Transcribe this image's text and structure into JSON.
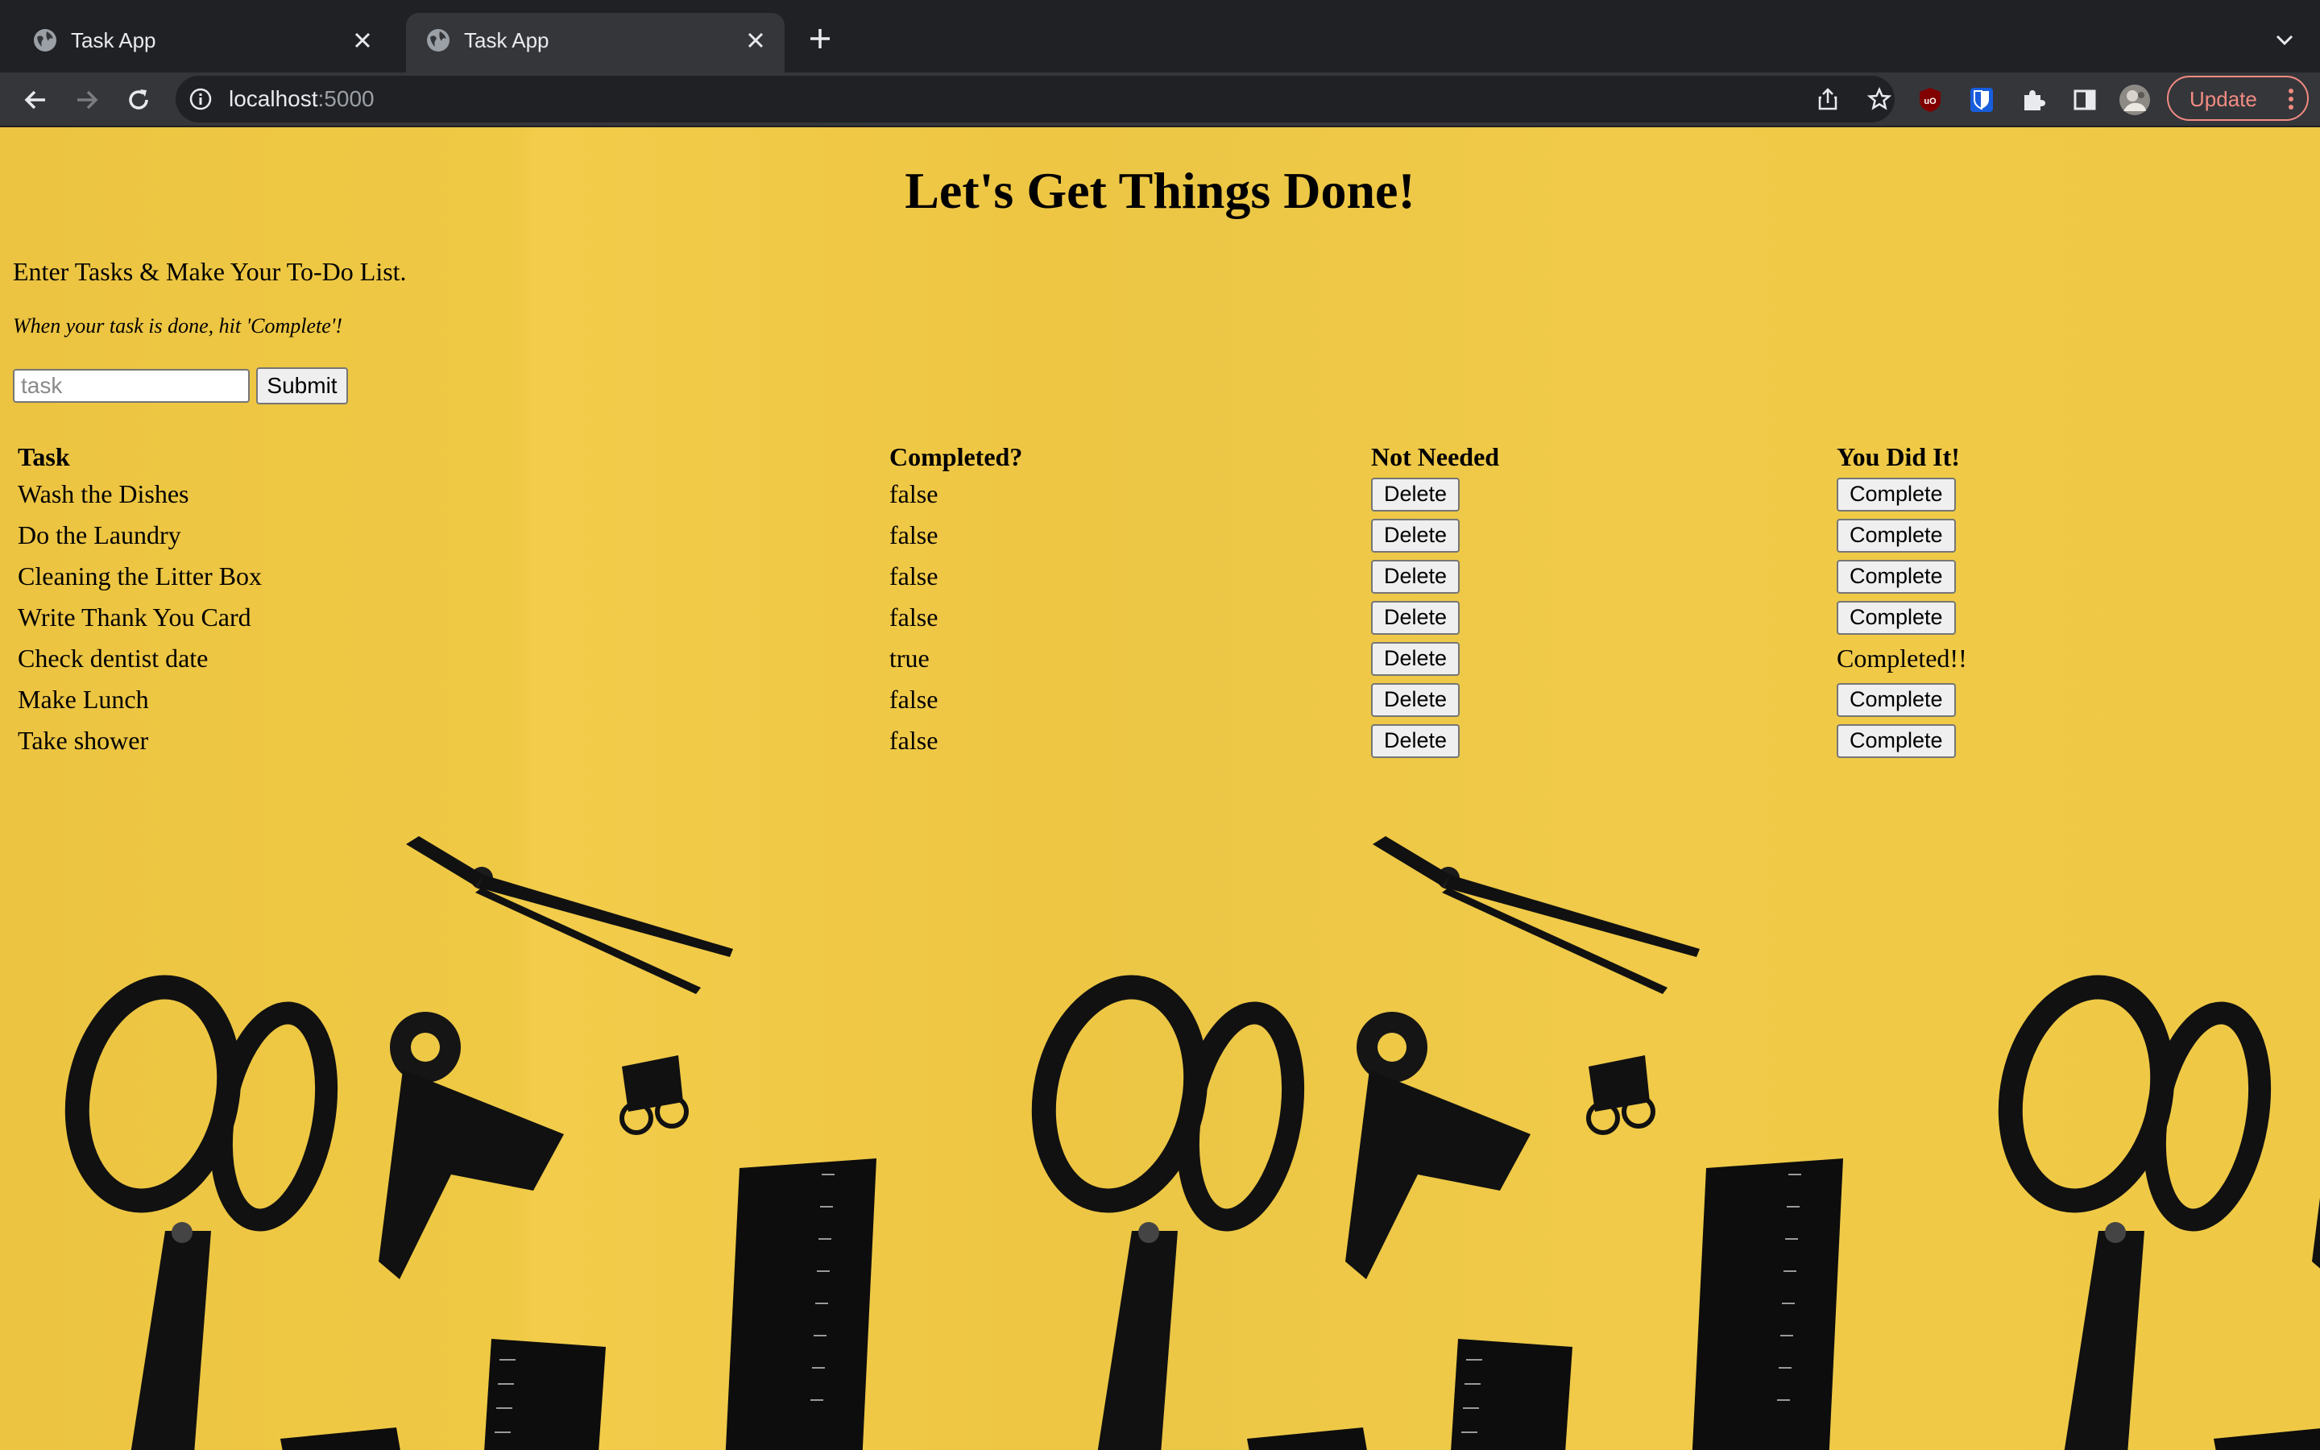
{
  "browser": {
    "tabs": [
      {
        "title": "Task App",
        "active": false
      },
      {
        "title": "Task App",
        "active": true
      }
    ],
    "url_host": "localhost",
    "url_port": ":5000",
    "update_label": "Update"
  },
  "page": {
    "title": "Let's Get Things Done!",
    "intro": "Enter Tasks & Make Your To-Do List.",
    "hint": "When your task is done, hit 'Complete'!",
    "input_placeholder": "task",
    "submit_label": "Submit",
    "background": "yellow background with black scissors, compass, binder clips and rulers"
  },
  "table": {
    "headers": [
      "Task",
      "Completed?",
      "Not Needed",
      "You Did It!"
    ],
    "delete_label": "Delete",
    "complete_label": "Complete",
    "completed_text": "Completed!!",
    "rows": [
      {
        "task": "Wash the Dishes",
        "completed": "false"
      },
      {
        "task": "Do the Laundry",
        "completed": "false"
      },
      {
        "task": "Cleaning the Litter Box",
        "completed": "false"
      },
      {
        "task": "Write Thank You Card",
        "completed": "false"
      },
      {
        "task": "Check dentist date",
        "completed": "true"
      },
      {
        "task": "Make Lunch",
        "completed": "false"
      },
      {
        "task": "Take shower",
        "completed": "false"
      }
    ]
  },
  "colors": {
    "page_bg": "#efc845",
    "chrome_dark": "#202124",
    "chrome_toolbar": "#35363a",
    "update_accent": "#f28b82"
  }
}
